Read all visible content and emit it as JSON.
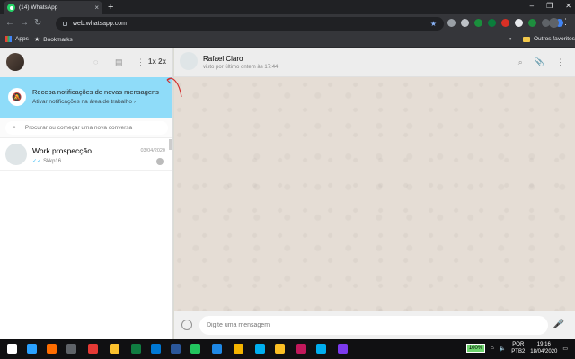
{
  "browser": {
    "tab_title": "(14) WhatsApp",
    "tab_close": "×",
    "new_tab": "+",
    "window_controls": [
      "–",
      "❐",
      "✕"
    ],
    "url": "web.whatsapp.com",
    "bookmarks": {
      "apps": "Apps",
      "bookmarks": "Bookmarks",
      "other": "Outros favoritos",
      "overflow": "»"
    },
    "extension_colors": [
      "#9aa0a6",
      "#bdc1c6",
      "#1a8f3c",
      "#0a7d3b",
      "#d93025",
      "#e8eaed",
      "#1e8e3e",
      "#5f6368",
      "#4285f4"
    ]
  },
  "whatsapp": {
    "left_header": {
      "speed_label": "1x 2x"
    },
    "notification": {
      "title": "Receba notificações de novas mensagens",
      "subtitle": "Ativar notificações na área de trabalho ›"
    },
    "search": {
      "placeholder": "Procurar ou começar uma nova conversa"
    },
    "chats": [
      {
        "name": "Work prospecção",
        "date": "03/04/2020",
        "last_message": "Skkp16"
      }
    ],
    "conversation": {
      "name": "Rafael Claro",
      "status": "visto por último ontem às 17:44"
    },
    "composer": {
      "placeholder": "Digite uma mensagem"
    }
  },
  "taskbar": {
    "battery": "100%",
    "lang_top": "POR",
    "lang_bottom": "PTB2",
    "time": "19:16",
    "date": "18/04/2020",
    "app_colors": [
      "#2aa1ff",
      "#ff6d00",
      "#5f6368",
      "#e53935",
      "#fbc02d",
      "#107c41",
      "#0078d4",
      "#2b579a",
      "#22c55e",
      "#1e88e5",
      "#f4b400",
      "#00aff0",
      "#fbbf24",
      "#c2185b",
      "#00aeef",
      "#7c3aed"
    ]
  }
}
